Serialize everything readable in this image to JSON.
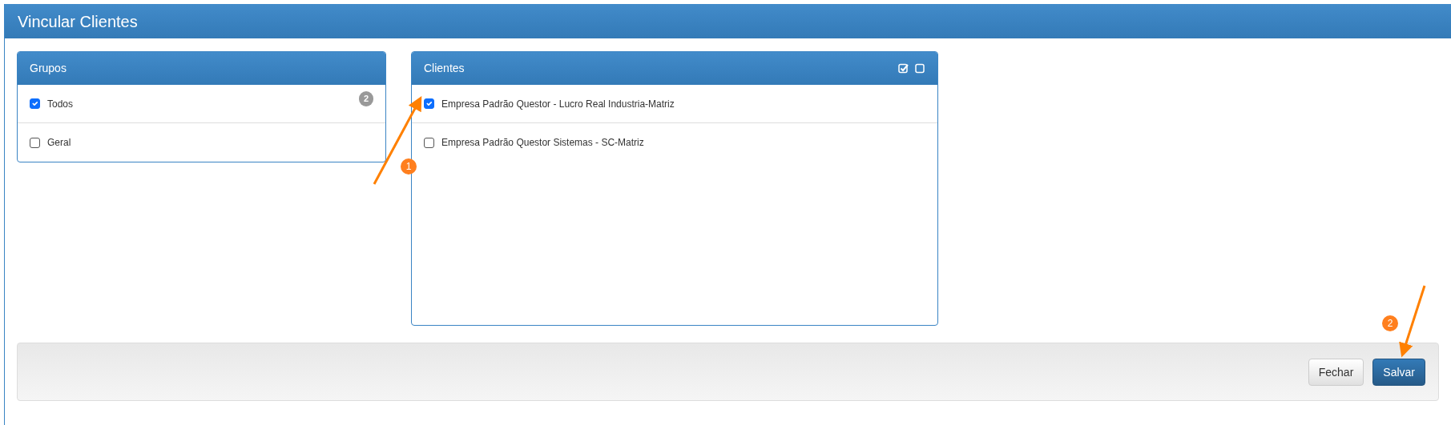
{
  "window": {
    "title": "Vincular Clientes"
  },
  "groups": {
    "title": "Grupos",
    "items": [
      {
        "label": "Todos",
        "checked": true,
        "badge": "2"
      },
      {
        "label": "Geral",
        "checked": false
      }
    ]
  },
  "clients": {
    "title": "Clientes",
    "header_actions": [
      {
        "kind": "check-all"
      },
      {
        "kind": "uncheck-all"
      }
    ],
    "items": [
      {
        "label": "Empresa Padrão Questor - Lucro Real Industria-Matriz",
        "checked": true
      },
      {
        "label": "Empresa Padrão Questor Sistemas - SC-Matriz",
        "checked": false
      }
    ]
  },
  "buttons": [
    {
      "label": "Fechar",
      "kind": "default"
    },
    {
      "label": "Salvar",
      "kind": "primary"
    }
  ],
  "annotations": [
    {
      "number": "1"
    },
    {
      "number": "2"
    }
  ]
}
